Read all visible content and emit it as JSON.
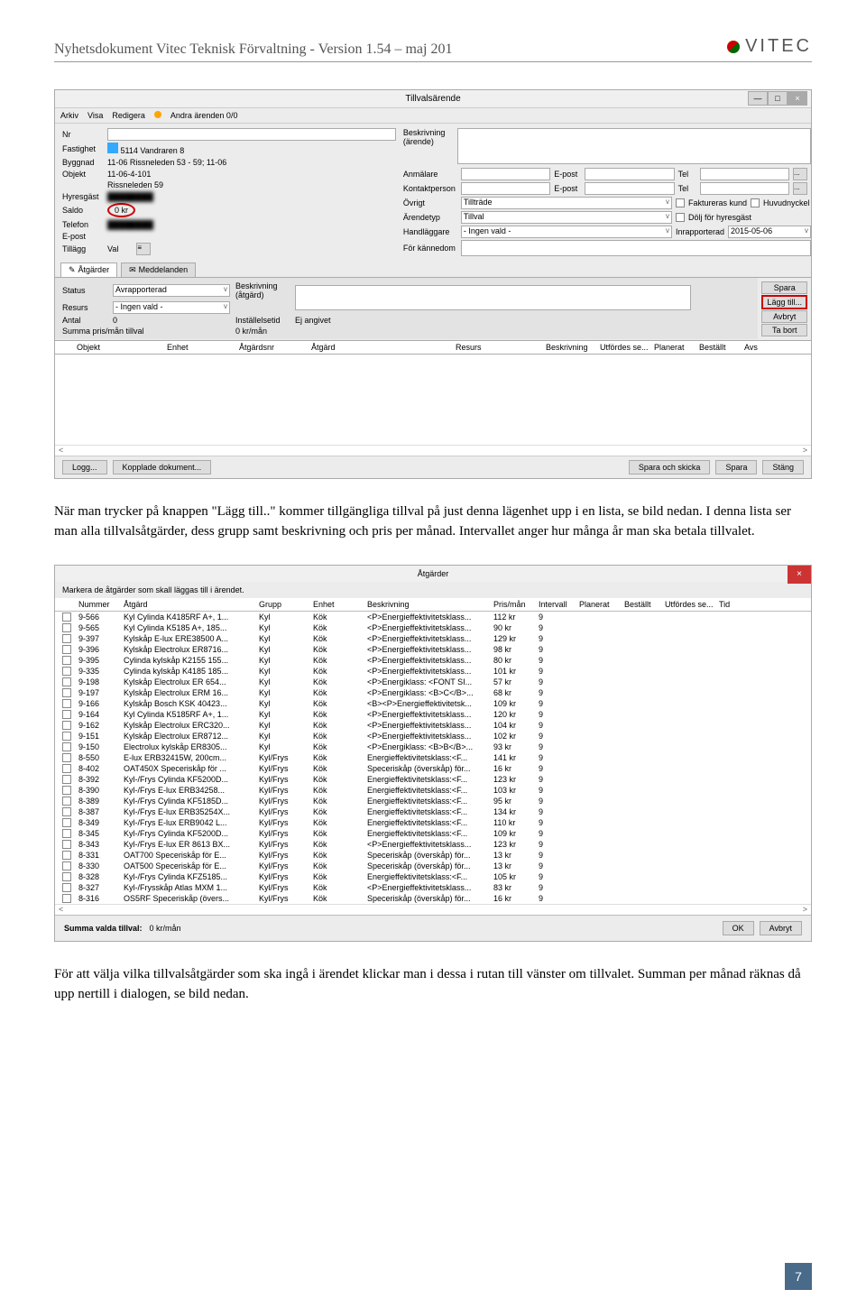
{
  "header_title": "Nyhetsdokument Vitec Teknisk Förvaltning - Version 1.54 – maj 201",
  "logo_text": "VITEC",
  "w1": {
    "title": "Tillvalsärende",
    "menu": [
      "Arkiv",
      "Visa",
      "Redigera",
      "Andra ärenden 0/0"
    ],
    "left": {
      "nr": "Nr",
      "nr_v": "",
      "fastighet": "Fastighet",
      "fastighet_v": "5114 Vandraren 8",
      "byggnad": "Byggnad",
      "byggnad_v": "11-06 Rissneleden 53 - 59; 11-06",
      "objekt": "Objekt",
      "objekt_v": "11-06-4-101",
      "adr": "Rissneleden 59",
      "hyresgast": "Hyresgäst",
      "saldo": "Saldo",
      "saldo_v": "0 kr",
      "telefon": "Telefon",
      "epost": "E-post",
      "tillagg": "Tillägg",
      "val": "Val",
      "val_btn": "..."
    },
    "right": {
      "besk": "Beskrivning (ärende)",
      "anmalare": "Anmälare",
      "epost": "E-post",
      "tel": "Tel",
      "kontakt": "Kontaktperson",
      "ovrigt": "Övrigt",
      "ovrigt_v": "Tillträde",
      "faktureras": "Faktureras kund",
      "huvud": "Huvudnyckel",
      "arende": "Ärendetyp",
      "arende_v": "Tillval",
      "dolj": "Dölj för hyresgäst",
      "handl": "Handläggare",
      "handl_v": "- Ingen vald -",
      "inrapp": "Inrapporterad",
      "inrapp_v": "2015-05-06",
      "kannedom": "För kännedom"
    },
    "tabs": [
      "Åtgärder",
      "Meddelanden"
    ],
    "sec2": {
      "status": "Status",
      "status_v": "Avrapporterad",
      "resurs": "Resurs",
      "resurs_v": "- Ingen vald -",
      "besk": "Beskrivning (åtgärd)",
      "antal": "Antal",
      "antal_v": "0",
      "inst": "Inställelsetid",
      "inst_v": "Ej angivet",
      "summa": "Summa pris/mån tillval",
      "summa_v": "0 kr/mån",
      "btns": [
        "Spara",
        "Lägg till...",
        "Avbryt",
        "Ta bort"
      ]
    },
    "cols": [
      "Objekt",
      "Enhet",
      "Åtgärdsnr",
      "Åtgärd",
      "Resurs",
      "Beskrivning",
      "Utfördes se...",
      "Planerat",
      "Beställt",
      "Avs"
    ],
    "foot_l": [
      "Logg...",
      "Kopplade dokument..."
    ],
    "foot_r": [
      "Spara och skicka",
      "Spara",
      "Stäng"
    ]
  },
  "para1": "När man trycker på knappen \"Lägg till..\" kommer tillgängliga tillval på just denna lägenhet upp i en lista, se bild nedan. I denna lista ser man alla tillvalsåtgärder, dess grupp samt beskrivning och pris per månad. Intervallet anger hur många år man ska betala tillvalet.",
  "w2": {
    "title": "Åtgärder",
    "inst": "Markera de åtgärder som skall läggas till i ärendet.",
    "cols": [
      "",
      "Nummer",
      "Åtgärd",
      "Grupp",
      "Enhet",
      "Beskrivning",
      "Pris/mån",
      "Intervall",
      "Planerat",
      "Beställt",
      "Utfördes se...",
      "Tid"
    ],
    "rows": [
      [
        "9-566",
        "Kyl Cylinda K4185RF A+, 1...",
        "Kyl",
        "Kök",
        "<P>Energieffektivitetsklass...",
        "112 kr",
        "9"
      ],
      [
        "9-565",
        "Kyl Cylinda K5185 A+, 185...",
        "Kyl",
        "Kök",
        "<P>Energieffektivitetsklass...",
        "90 kr",
        "9"
      ],
      [
        "9-397",
        "Kylskåp E-lux ERE38500 A...",
        "Kyl",
        "Kök",
        "<P>Energieffektivitetsklass...",
        "129 kr",
        "9"
      ],
      [
        "9-396",
        "Kylskåp Electrolux ER8716...",
        "Kyl",
        "Kök",
        "<P>Energieffektivitetsklass...",
        "98 kr",
        "9"
      ],
      [
        "9-395",
        "Cylinda kylskåp K2155 155...",
        "Kyl",
        "Kök",
        "<P>Energieffektivitetsklass...",
        "80 kr",
        "9"
      ],
      [
        "9-335",
        "Cylinda kylskåp K4185 185...",
        "Kyl",
        "Kök",
        "<P>Energieffektivitetsklass...",
        "101 kr",
        "9"
      ],
      [
        "9-198",
        "Kylskåp Electrolux ER 654...",
        "Kyl",
        "Kök",
        "<P>Energiklass: <FONT SI...",
        "57 kr",
        "9"
      ],
      [
        "9-197",
        "Kylskåp Electrolux ERM 16...",
        "Kyl",
        "Kök",
        "<P>Energiklass: <B>C</B>...",
        "68 kr",
        "9"
      ],
      [
        "9-166",
        "Kylskåp Bosch KSK 40423...",
        "Kyl",
        "Kök",
        "<B><P>Energieffektivitetsk...",
        "109 kr",
        "9"
      ],
      [
        "9-164",
        "Kyl Cylinda K5185RF A+, 1...",
        "Kyl",
        "Kök",
        "<P>Energieffektivitetsklass...",
        "120 kr",
        "9"
      ],
      [
        "9-162",
        "Kylskåp Electrolux ERC320...",
        "Kyl",
        "Kök",
        "<P>Energieffektivitetsklass...",
        "104 kr",
        "9"
      ],
      [
        "9-151",
        "Kylskåp Electrolux ER8712...",
        "Kyl",
        "Kök",
        "<P>Energieffektivitetsklass...",
        "102 kr",
        "9"
      ],
      [
        "9-150",
        "Electrolux kylskåp ER8305...",
        "Kyl",
        "Kök",
        "<P>Energiklass: <B>B</B>...",
        "93 kr",
        "9"
      ],
      [
        "8-550",
        "E-lux ERB32415W, 200cm...",
        "Kyl/Frys",
        "Kök",
        "Energieffektivitetsklass:<F...",
        "141 kr",
        "9"
      ],
      [
        "8-402",
        "OAT450X Speceriskåp för ...",
        "Kyl/Frys",
        "Kök",
        "Speceriskåp (överskåp) för...",
        "16 kr",
        "9"
      ],
      [
        "8-392",
        "Kyl-/Frys Cylinda KF5200D...",
        "Kyl/Frys",
        "Kök",
        "Energieffektivitetsklass:<F...",
        "123 kr",
        "9"
      ],
      [
        "8-390",
        "Kyl-/Frys E-lux ERB34258...",
        "Kyl/Frys",
        "Kök",
        "Energieffektivitetsklass:<F...",
        "103 kr",
        "9"
      ],
      [
        "8-389",
        "Kyl-/Frys Cylinda KF5185D...",
        "Kyl/Frys",
        "Kök",
        "Energieffektivitetsklass:<F...",
        "95 kr",
        "9"
      ],
      [
        "8-387",
        "Kyl-/Frys E-lux ERB35254X...",
        "Kyl/Frys",
        "Kök",
        "Energieffektivitetsklass:<F...",
        "134 kr",
        "9"
      ],
      [
        "8-349",
        "Kyl-/Frys E-lux ERB9042 L...",
        "Kyl/Frys",
        "Kök",
        "Energieffektivitetsklass:<F...",
        "110 kr",
        "9"
      ],
      [
        "8-345",
        "Kyl-/Frys Cylinda KF5200D...",
        "Kyl/Frys",
        "Kök",
        "Energieffektivitetsklass:<F...",
        "109 kr",
        "9"
      ],
      [
        "8-343",
        "Kyl-/Frys E-lux ER 8613 BX...",
        "Kyl/Frys",
        "Kök",
        "<P>Energieffektivitetsklass...",
        "123 kr",
        "9"
      ],
      [
        "8-331",
        "OAT700 Speceriskåp för E...",
        "Kyl/Frys",
        "Kök",
        "Speceriskåp (överskåp) för...",
        "13 kr",
        "9"
      ],
      [
        "8-330",
        "OAT500 Speceriskåp för E...",
        "Kyl/Frys",
        "Kök",
        "Speceriskåp (överskåp) för...",
        "13 kr",
        "9"
      ],
      [
        "8-328",
        "Kyl-/Frys Cylinda KFZ5185...",
        "Kyl/Frys",
        "Kök",
        "Energieffektivitetsklass:<F...",
        "105 kr",
        "9"
      ],
      [
        "8-327",
        "Kyl-/Frysskåp Atlas MXM 1...",
        "Kyl/Frys",
        "Kök",
        "<P>Energieffektivitetsklass...",
        "83 kr",
        "9"
      ],
      [
        "8-316",
        "OS5RF Speceriskåp (övers...",
        "Kyl/Frys",
        "Kök",
        "Speceriskåp (överskåp) för...",
        "16 kr",
        "9"
      ]
    ],
    "summa": "Summa valda tillval:",
    "summa_v": "0 kr/mån",
    "ok": "OK",
    "avbryt": "Avbryt"
  },
  "para2": "För att välja vilka tillvalsåtgärder som ska ingå i ärendet klickar man i dessa i rutan till vänster om tillvalet. Summan per månad räknas då upp nertill i dialogen, se bild nedan.",
  "pagenum": "7"
}
